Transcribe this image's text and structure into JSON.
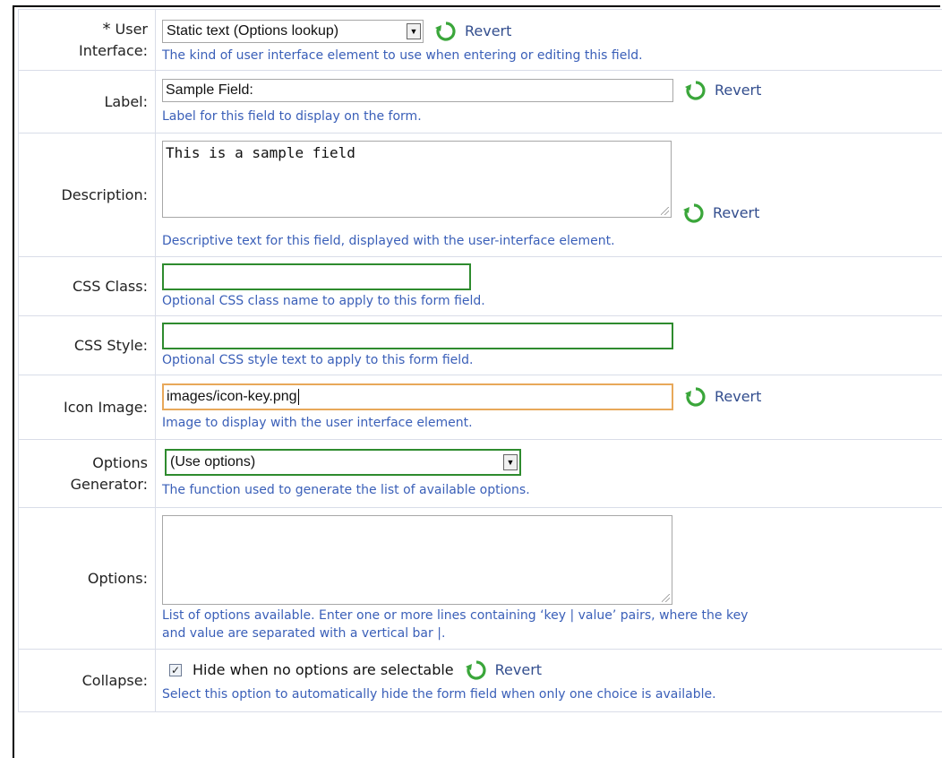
{
  "rows": {
    "ui": {
      "label_line1": "User",
      "label_line2": "Interface:",
      "required_mark": "*",
      "select_value": "Static text (Options lookup)",
      "revert": "Revert",
      "help": "The kind of user interface element to use when entering or editing this field."
    },
    "label": {
      "label": "Label:",
      "value": "Sample Field:",
      "revert": "Revert",
      "help": "Label for this field to display on the form."
    },
    "description": {
      "label": "Description:",
      "value": "This is a sample field",
      "revert": "Revert",
      "help": "Descriptive text for this field, displayed with the user-interface element."
    },
    "css_class": {
      "label": "CSS Class:",
      "value": "",
      "help": "Optional CSS class name to apply to this form field."
    },
    "css_style": {
      "label": "CSS Style:",
      "value": "",
      "help": "Optional CSS style text to apply to this form field."
    },
    "icon_image": {
      "label": "Icon Image:",
      "value": "images/icon-key.png",
      "revert": "Revert",
      "help": "Image to display with the user interface element."
    },
    "options_generator": {
      "label_line1": "Options",
      "label_line2": "Generator:",
      "select_value": "(Use options)",
      "help": "The function used to generate the list of available options."
    },
    "options": {
      "label": "Options:",
      "value": "",
      "help_line1": "List of options available. Enter one or more lines containing ‘key | value’ pairs, where the key",
      "help_line2": "and value are separated with a vertical bar |."
    },
    "collapse": {
      "label": "Collapse:",
      "checked": true,
      "checkbox_label": "Hide when no options are selectable",
      "revert": "Revert",
      "help": "Select this option to automatically hide the form field when only one choice is available."
    }
  },
  "colors": {
    "help_text": "#3a5fb8",
    "revert_text": "#334e8e",
    "focus_border": "#2e8b2e",
    "active_border": "#e8a85a"
  },
  "icons": {
    "revert": "revert-icon",
    "dropdown": "chevron-down-icon",
    "check": "check-icon"
  }
}
